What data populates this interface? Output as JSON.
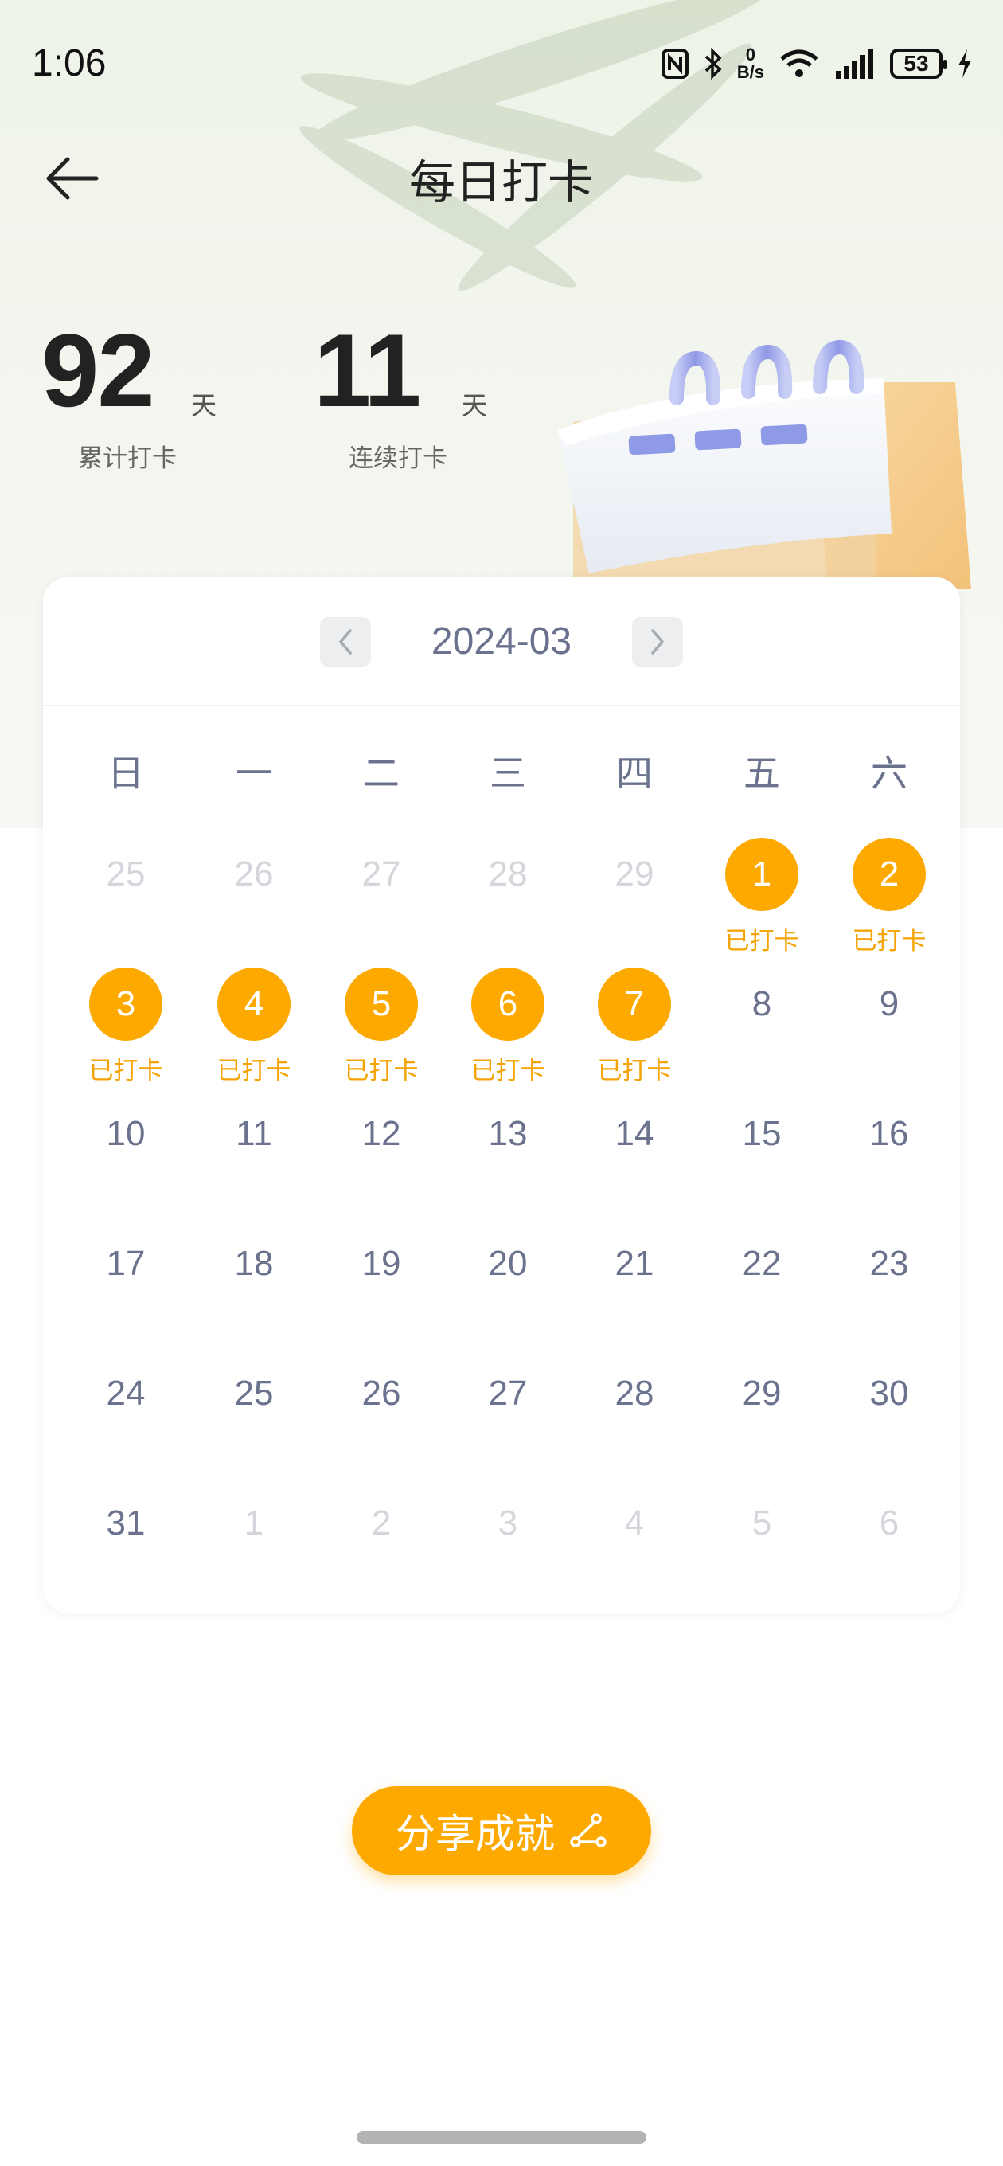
{
  "status_bar": {
    "time": "1:06",
    "net_speed_value": "0",
    "net_speed_unit": "B/s",
    "battery": "53"
  },
  "header": {
    "title": "每日打卡"
  },
  "stats": [
    {
      "value": "92",
      "unit": "天",
      "label": "累计打卡"
    },
    {
      "value": "11",
      "unit": "天",
      "label": "连续打卡"
    }
  ],
  "calendar": {
    "month": "2024-03",
    "weekdays": [
      "日",
      "一",
      "二",
      "三",
      "四",
      "五",
      "六"
    ],
    "checked_label": "已打卡",
    "days": [
      {
        "d": "25",
        "other": true
      },
      {
        "d": "26",
        "other": true
      },
      {
        "d": "27",
        "other": true
      },
      {
        "d": "28",
        "other": true
      },
      {
        "d": "29",
        "other": true
      },
      {
        "d": "1",
        "checked": true
      },
      {
        "d": "2",
        "checked": true
      },
      {
        "d": "3",
        "checked": true
      },
      {
        "d": "4",
        "checked": true
      },
      {
        "d": "5",
        "checked": true
      },
      {
        "d": "6",
        "checked": true
      },
      {
        "d": "7",
        "checked": true
      },
      {
        "d": "8"
      },
      {
        "d": "9"
      },
      {
        "d": "10"
      },
      {
        "d": "11"
      },
      {
        "d": "12"
      },
      {
        "d": "13"
      },
      {
        "d": "14"
      },
      {
        "d": "15"
      },
      {
        "d": "16"
      },
      {
        "d": "17"
      },
      {
        "d": "18"
      },
      {
        "d": "19"
      },
      {
        "d": "20"
      },
      {
        "d": "21"
      },
      {
        "d": "22"
      },
      {
        "d": "23"
      },
      {
        "d": "24"
      },
      {
        "d": "25"
      },
      {
        "d": "26"
      },
      {
        "d": "27"
      },
      {
        "d": "28"
      },
      {
        "d": "29"
      },
      {
        "d": "30"
      },
      {
        "d": "31"
      },
      {
        "d": "1",
        "other": true
      },
      {
        "d": "2",
        "other": true
      },
      {
        "d": "3",
        "other": true
      },
      {
        "d": "4",
        "other": true
      },
      {
        "d": "5",
        "other": true
      },
      {
        "d": "6",
        "other": true
      }
    ]
  },
  "share_button": {
    "label": "分享成就",
    "icon": "share-icon"
  },
  "colors": {
    "accent": "#fda900",
    "checked_text": "#f5a300",
    "muted_date": "#d4d6dc",
    "date_text": "#6b728e"
  }
}
